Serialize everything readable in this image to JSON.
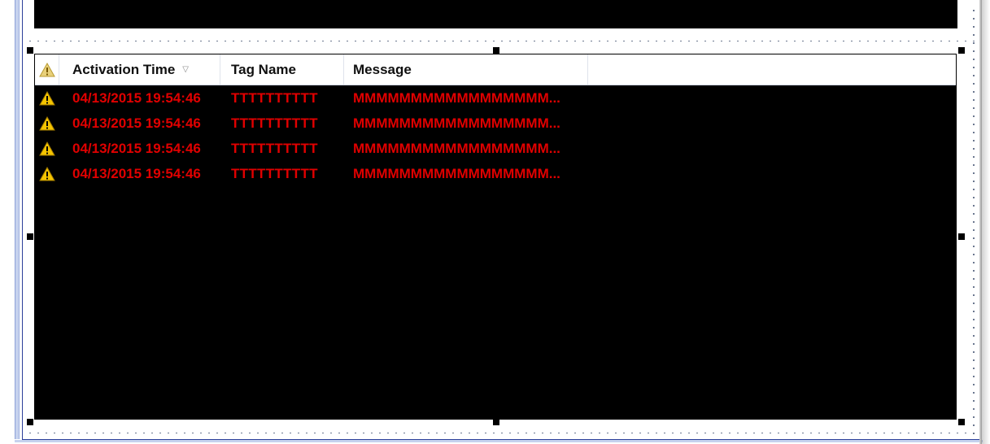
{
  "alarm_grid": {
    "columns": [
      {
        "label": ""
      },
      {
        "label": "Activation Time",
        "sort_indicator": "▽"
      },
      {
        "label": "Tag Name"
      },
      {
        "label": "Message"
      },
      {
        "label": ""
      }
    ],
    "rows": [
      {
        "icon": "warning-icon",
        "activation_time": "04/13/2015 19:54:46",
        "tag_name": "TTTTTTTTTT",
        "message": "MMMMMMMMMMMMMMMMM..."
      },
      {
        "icon": "warning-icon",
        "activation_time": "04/13/2015 19:54:46",
        "tag_name": "TTTTTTTTTT",
        "message": "MMMMMMMMMMMMMMMMM..."
      },
      {
        "icon": "warning-icon",
        "activation_time": "04/13/2015 19:54:46",
        "tag_name": "TTTTTTTTTT",
        "message": "MMMMMMMMMMMMMMMMM..."
      },
      {
        "icon": "warning-icon",
        "activation_time": "04/13/2015 19:54:46",
        "tag_name": "TTTTTTTTTT",
        "message": "MMMMMMMMMMMMMMMMM..."
      }
    ]
  },
  "colors": {
    "grid_background": "#000000",
    "alarm_text": "#e00000",
    "warning_fill": "#f5c400",
    "header_background": "#ffffff"
  }
}
